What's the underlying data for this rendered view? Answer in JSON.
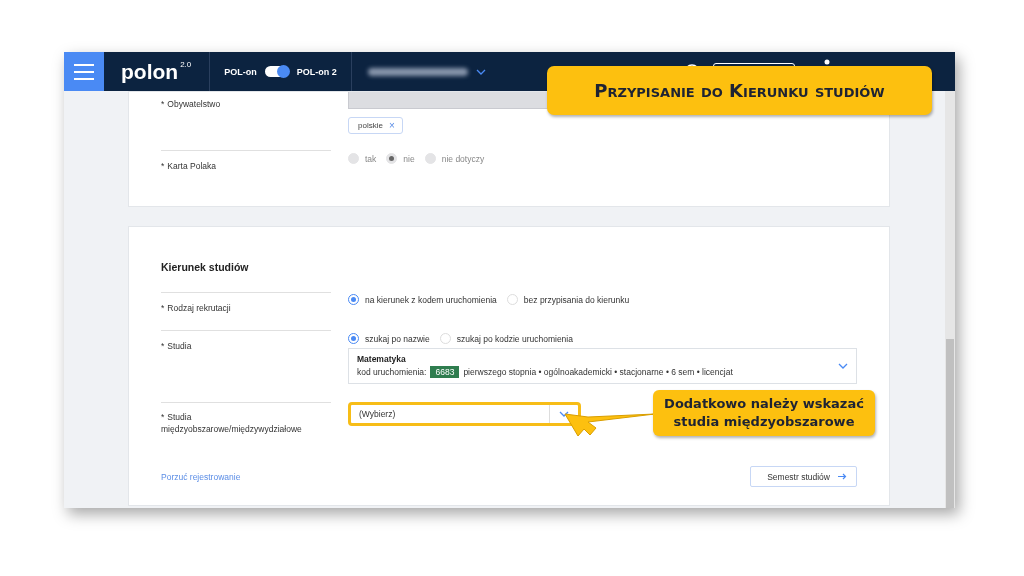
{
  "navbar": {
    "logo": "polon",
    "logo_version": "2.0",
    "switch_left": "POL-on",
    "switch_on": true,
    "switch_right": "POL-on 2"
  },
  "callout_title": "Przypisanie do Kierunku studiów",
  "callout_hint": [
    "Dodatkowo należy wskazać",
    "studia międzyobszarowe"
  ],
  "personal": {
    "citizenship": {
      "label": "Obywatelstwo",
      "required_mark": "*",
      "chip": "polskie",
      "chip_remove": "×"
    },
    "polish_card": {
      "label": "Karta Polaka",
      "required_mark": "*",
      "disabled": true,
      "options": [
        {
          "label": "tak",
          "selected": false
        },
        {
          "label": "nie",
          "selected": true
        },
        {
          "label": "nie dotyczy",
          "selected": false
        }
      ]
    }
  },
  "study": {
    "heading": "Kierunek studiów",
    "recruitment": {
      "label": "Rodzaj rekrutacji",
      "required_mark": "*",
      "options": [
        {
          "label": "na kierunek z kodem uruchomienia",
          "selected": true
        },
        {
          "label": "bez przypisania do kierunku",
          "selected": false
        }
      ]
    },
    "studies": {
      "label": "Studia",
      "required_mark": "*",
      "options": [
        {
          "label": "szukaj po nazwie",
          "selected": true
        },
        {
          "label": "szukaj po kodzie uruchomienia",
          "selected": false
        }
      ],
      "selection": {
        "name": "Matematyka",
        "code_label": "kod uruchomienia:",
        "code": "6683",
        "details": "pierwszego stopnia • ogólnoakademicki • stacjonarne • 6 sem • licencjat"
      }
    },
    "interdisciplinary": {
      "label": "Studia międzyobszarowe/międzywydziałowe",
      "required_mark": "*",
      "placeholder": "(Wybierz)",
      "highlighted": true
    },
    "abandon_link": "Porzuć rejestrowanie",
    "next_button": "Semestr studiów"
  }
}
